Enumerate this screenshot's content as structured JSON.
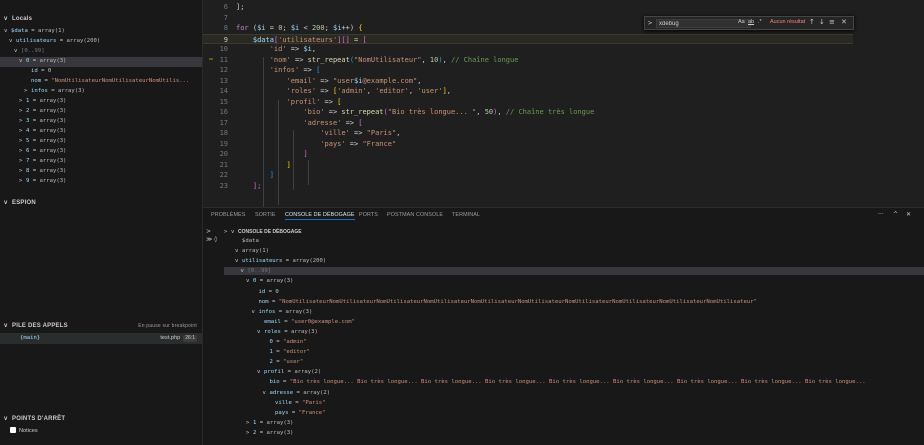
{
  "sidebar": {
    "locals_title": "Locals",
    "variables": [
      {
        "depth": 0,
        "twisty": "v",
        "key": "$data",
        "value": "array(1)",
        "sel": false
      },
      {
        "depth": 1,
        "twisty": "v",
        "key": "utilisateurs",
        "value": "array(200)",
        "sel": false
      },
      {
        "depth": 2,
        "twisty": "v",
        "key": "",
        "value": "[0..99]",
        "sel": false,
        "dim": true
      },
      {
        "depth": 3,
        "twisty": "v",
        "key": "0",
        "value": "array(3)",
        "sel": true
      },
      {
        "depth": 4,
        "twisty": "",
        "key": "id",
        "value": "0",
        "sel": false,
        "num": true
      },
      {
        "depth": 4,
        "twisty": "",
        "key": "nom",
        "value": "\"NomUtilisateurNomUtilisateurNomUtilis...",
        "sel": false,
        "str": true
      },
      {
        "depth": 4,
        "twisty": ">",
        "key": "infos",
        "value": "array(3)",
        "sel": false
      },
      {
        "depth": 3,
        "twisty": ">",
        "key": "1",
        "value": "array(3)",
        "sel": false
      },
      {
        "depth": 3,
        "twisty": ">",
        "key": "2",
        "value": "array(3)",
        "sel": false
      },
      {
        "depth": 3,
        "twisty": ">",
        "key": "3",
        "value": "array(3)",
        "sel": false
      },
      {
        "depth": 3,
        "twisty": ">",
        "key": "4",
        "value": "array(3)",
        "sel": false
      },
      {
        "depth": 3,
        "twisty": ">",
        "key": "5",
        "value": "array(3)",
        "sel": false
      },
      {
        "depth": 3,
        "twisty": ">",
        "key": "6",
        "value": "array(3)",
        "sel": false
      },
      {
        "depth": 3,
        "twisty": ">",
        "key": "7",
        "value": "array(3)",
        "sel": false
      },
      {
        "depth": 3,
        "twisty": ">",
        "key": "8",
        "value": "array(3)",
        "sel": false
      },
      {
        "depth": 3,
        "twisty": ">",
        "key": "9",
        "value": "array(3)",
        "sel": false
      }
    ],
    "watch_title": "ESPION",
    "callstack_title": "PILE DES APPELS",
    "callstack_status": "En pause sur breakpoint",
    "callstack_frame": "{main}",
    "callstack_file": "test.php",
    "callstack_line": "26:1",
    "breakpoints_title": "POINTS D'ARRÊT",
    "breakpoint_item": "Notices"
  },
  "editor": {
    "lines": [
      {
        "n": "6",
        "code": [
          [
            "op",
            "];"
          ]
        ]
      },
      {
        "n": "7",
        "code": []
      },
      {
        "n": "8",
        "code": [
          [
            "kw",
            "for"
          ],
          [
            "op",
            " ("
          ],
          [
            "var",
            "$i"
          ],
          [
            "op",
            " = "
          ],
          [
            "num",
            "0"
          ],
          [
            "op",
            "; "
          ],
          [
            "var",
            "$i"
          ],
          [
            "op",
            " < "
          ],
          [
            "num",
            "200"
          ],
          [
            "op",
            "; "
          ],
          [
            "var",
            "$i"
          ],
          [
            "op",
            "++) "
          ],
          [
            "br1",
            "{"
          ]
        ]
      },
      {
        "n": "9",
        "hl": true,
        "code": [
          [
            "op",
            "    "
          ],
          [
            "var",
            "$data"
          ],
          [
            "br2",
            "["
          ],
          [
            "str",
            "'utilisateurs'"
          ],
          [
            "br2",
            "]"
          ],
          [
            "br2",
            "[]"
          ],
          [
            "op",
            " = "
          ],
          [
            "br2",
            "["
          ]
        ]
      },
      {
        "n": "10",
        "code": [
          [
            "op",
            "        "
          ],
          [
            "str",
            "'id'"
          ],
          [
            "op",
            " => "
          ],
          [
            "var",
            "$i"
          ],
          [
            "op",
            ","
          ]
        ]
      },
      {
        "n": "11",
        "code": [
          [
            "op",
            "        "
          ],
          [
            "str",
            "'nom'"
          ],
          [
            "op",
            " => "
          ],
          [
            "fn",
            "str_repeat"
          ],
          [
            "br3",
            "("
          ],
          [
            "str",
            "\"NomUtilisateur\""
          ],
          [
            "op",
            ", "
          ],
          [
            "num",
            "10"
          ],
          [
            "br3",
            ")"
          ],
          [
            "op",
            ", "
          ],
          [
            "cmt",
            "// Chaîne longue"
          ]
        ]
      },
      {
        "n": "12",
        "code": [
          [
            "op",
            "        "
          ],
          [
            "str",
            "'infos'"
          ],
          [
            "op",
            " => "
          ],
          [
            "br3",
            "["
          ]
        ]
      },
      {
        "n": "13",
        "code": [
          [
            "op",
            "            "
          ],
          [
            "str",
            "'email'"
          ],
          [
            "op",
            " => "
          ],
          [
            "str",
            "\"user"
          ],
          [
            "var",
            "$i"
          ],
          [
            "str",
            "@example.com\""
          ],
          [
            "op",
            ","
          ]
        ]
      },
      {
        "n": "14",
        "code": [
          [
            "op",
            "            "
          ],
          [
            "str",
            "'roles'"
          ],
          [
            "op",
            " => "
          ],
          [
            "br1",
            "["
          ],
          [
            "str",
            "'admin'"
          ],
          [
            "op",
            ", "
          ],
          [
            "str",
            "'editor'"
          ],
          [
            "op",
            ", "
          ],
          [
            "str",
            "'user'"
          ],
          [
            "br1",
            "]"
          ],
          [
            "op",
            ","
          ]
        ]
      },
      {
        "n": "15",
        "code": [
          [
            "op",
            "            "
          ],
          [
            "str",
            "'profil'"
          ],
          [
            "op",
            " => "
          ],
          [
            "br1",
            "["
          ]
        ]
      },
      {
        "n": "16",
        "code": [
          [
            "op",
            "                "
          ],
          [
            "str",
            "'bio'"
          ],
          [
            "op",
            " => "
          ],
          [
            "fn",
            "str_repeat"
          ],
          [
            "br2",
            "("
          ],
          [
            "str",
            "\"Bio très longue... \""
          ],
          [
            "op",
            ", "
          ],
          [
            "num",
            "50"
          ],
          [
            "br2",
            ")"
          ],
          [
            "op",
            ", "
          ],
          [
            "cmt",
            "// Chaîne très longue"
          ]
        ]
      },
      {
        "n": "17",
        "code": [
          [
            "op",
            "                "
          ],
          [
            "str",
            "'adresse'"
          ],
          [
            "op",
            " => "
          ],
          [
            "br2",
            "["
          ]
        ]
      },
      {
        "n": "18",
        "code": [
          [
            "op",
            "                    "
          ],
          [
            "str",
            "'ville'"
          ],
          [
            "op",
            " => "
          ],
          [
            "str",
            "\"Paris\""
          ],
          [
            "op",
            ","
          ]
        ]
      },
      {
        "n": "19",
        "code": [
          [
            "op",
            "                    "
          ],
          [
            "str",
            "'pays'"
          ],
          [
            "op",
            " => "
          ],
          [
            "str",
            "\"France\""
          ]
        ]
      },
      {
        "n": "20",
        "code": [
          [
            "op",
            "                "
          ],
          [
            "br2",
            "]"
          ]
        ]
      },
      {
        "n": "21",
        "code": [
          [
            "op",
            "            "
          ],
          [
            "br1",
            "]"
          ]
        ]
      },
      {
        "n": "22",
        "code": [
          [
            "op",
            "        "
          ],
          [
            "br3",
            "]"
          ]
        ]
      },
      {
        "n": "23",
        "code": [
          [
            "op",
            "    "
          ],
          [
            "br2",
            "];"
          ]
        ]
      }
    ],
    "find": {
      "query": "xdebug",
      "match_case": "Aa",
      "whole_word": "ab",
      "regex": ".*",
      "no_results": "Aucun résultat",
      "prev": "↑",
      "next": "↓",
      "menu": "≡",
      "close": "✕"
    }
  },
  "panel": {
    "tabs": [
      "PROBLÈMES",
      "SORTIE",
      "CONSOLE DE DÉBOGAGE",
      "PORTS",
      "POSTMAN CONSOLE",
      "TERMINAL"
    ],
    "active_tab": 2,
    "more": "···",
    "chevron": "^",
    "close": "✕",
    "console_header": "CONSOLE DE DÉBOGAGE",
    "rows": [
      {
        "depth": 0,
        "twisty": "",
        "key": "",
        "value": "$data",
        "plain": true
      },
      {
        "depth": 0,
        "twisty": "v",
        "key": "",
        "value": "array(1)",
        "plain": true
      },
      {
        "depth": 0,
        "twisty": "v",
        "key": "utilisateurs",
        "value": "array(200)"
      },
      {
        "depth": 1,
        "twisty": "v",
        "key": "",
        "value": "[0..99]",
        "dim": true,
        "sel": true
      },
      {
        "depth": 2,
        "twisty": "v",
        "key": "0",
        "value": "array(3)"
      },
      {
        "depth": 3,
        "twisty": "",
        "key": "id",
        "value": "0",
        "num": true
      },
      {
        "depth": 3,
        "twisty": "",
        "key": "nom",
        "value": "\"NomUtilisateurNomUtilisateurNomUtilisateurNomUtilisateurNomUtilisateurNomUtilisateurNomUtilisateurNomUtilisateurNomUtilisateurNomUtilisateur\"",
        "str": true
      },
      {
        "depth": 3,
        "twisty": "v",
        "key": "infos",
        "value": "array(3)"
      },
      {
        "depth": 4,
        "twisty": "",
        "key": "email",
        "value": "\"user0@example.com\"",
        "str": true
      },
      {
        "depth": 4,
        "twisty": "v",
        "key": "roles",
        "value": "array(3)"
      },
      {
        "depth": 5,
        "twisty": "",
        "key": "0",
        "value": "\"admin\"",
        "str": true
      },
      {
        "depth": 5,
        "twisty": "",
        "key": "1",
        "value": "\"editor\"",
        "str": true
      },
      {
        "depth": 5,
        "twisty": "",
        "key": "2",
        "value": "\"user\"",
        "str": true
      },
      {
        "depth": 4,
        "twisty": "v",
        "key": "profil",
        "value": "array(2)"
      },
      {
        "depth": 5,
        "twisty": "",
        "key": "bio",
        "value": "\"Bio très longue... Bio très longue... Bio très longue... Bio très longue... Bio très longue... Bio très longue... Bio très longue... Bio très longue... Bio très longue...",
        "str": true
      },
      {
        "depth": 5,
        "twisty": "v",
        "key": "adresse",
        "value": "array(2)"
      },
      {
        "depth": 6,
        "twisty": "",
        "key": "ville",
        "value": "\"Paris\"",
        "str": true
      },
      {
        "depth": 6,
        "twisty": "",
        "key": "pays",
        "value": "\"France\"",
        "str": true
      },
      {
        "depth": 2,
        "twisty": ">",
        "key": "1",
        "value": "array(3)"
      },
      {
        "depth": 2,
        "twisty": ">",
        "key": "2",
        "value": "array(3)"
      }
    ]
  },
  "colors": {
    "accent": "#0078d4",
    "breakpoint_arrow": "#ffcc00",
    "no_results": "#f48771"
  }
}
